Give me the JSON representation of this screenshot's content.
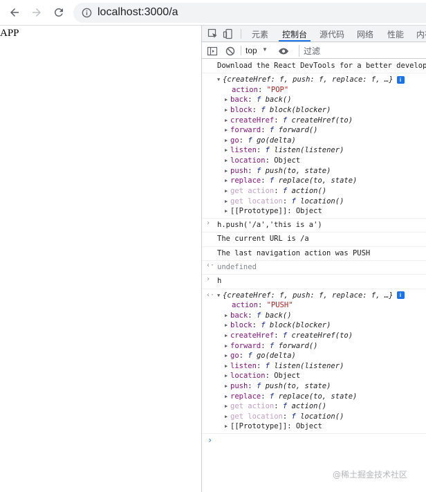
{
  "browser": {
    "url": "localhost:3000/a"
  },
  "page": {
    "text": "APP"
  },
  "devtools": {
    "tabs": [
      {
        "label": "元素",
        "active": false
      },
      {
        "label": "控制台",
        "active": true
      },
      {
        "label": "源代码",
        "active": false
      },
      {
        "label": "网络",
        "active": false
      },
      {
        "label": "性能",
        "active": false
      },
      {
        "label": "内存",
        "active": false
      }
    ],
    "context": "top",
    "filter_placeholder": "过滤",
    "console": {
      "banner": "Download the React DevTools for a better development",
      "obj1_summary": "{createHref: f, push: f, replace: f, …}",
      "obj1_action_key": "action",
      "obj1_action_value": "\"POP\"",
      "cmd1": "h.push('/a','this is a')",
      "log1": "The current URL is /a",
      "log2": "The last navigation action was PUSH",
      "result1": "undefined",
      "cmd2": "h",
      "obj2_summary": "{createHref: f, push: f, replace: f, …}",
      "obj2_action_key": "action",
      "obj2_action_value": "\"PUSH\"",
      "props": [
        {
          "key": "back",
          "value": "back()",
          "getter": false
        },
        {
          "key": "block",
          "value": "block(blocker)",
          "getter": false
        },
        {
          "key": "createHref",
          "value": "createHref(to)",
          "getter": false
        },
        {
          "key": "forward",
          "value": "forward()",
          "getter": false
        },
        {
          "key": "go",
          "value": "go(delta)",
          "getter": false
        },
        {
          "key": "listen",
          "value": "listen(listener)",
          "getter": false
        },
        {
          "key": "location",
          "value": "Object",
          "getter": false,
          "plain": true
        },
        {
          "key": "push",
          "value": "push(to, state)",
          "getter": false
        },
        {
          "key": "replace",
          "value": "replace(to, state)",
          "getter": false
        },
        {
          "key": "get action",
          "value": "action()",
          "getter": true
        },
        {
          "key": "get location",
          "value": "location()",
          "getter": true
        },
        {
          "key": "[[Prototype]]",
          "value": "Object",
          "getter": false,
          "plain": true,
          "proto": true
        }
      ],
      "fn_marker": "f"
    }
  },
  "watermark": "@稀土掘金技术社区",
  "colors": {
    "keyword": "#881280",
    "string": "#c41a16",
    "function_marker": "#0d22aa",
    "accent": "#1a73e8"
  }
}
